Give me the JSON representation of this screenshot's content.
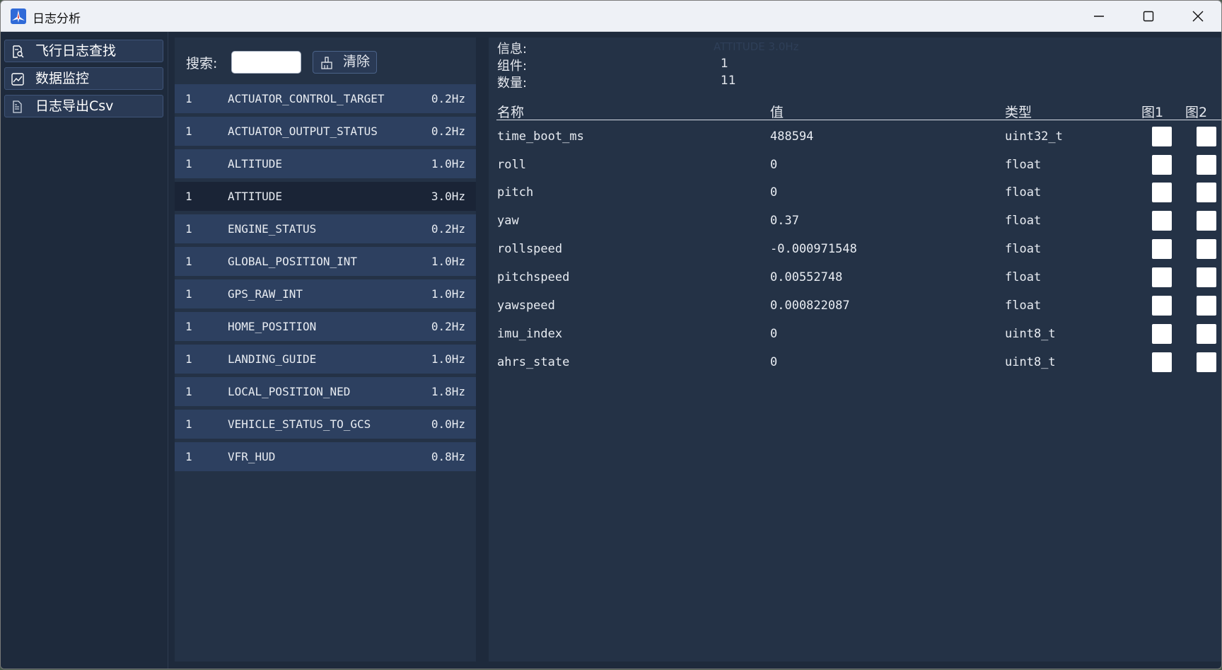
{
  "window": {
    "title": "日志分析",
    "minimize_icon": "minimize-icon",
    "maximize_icon": "maximize-icon",
    "close_icon": "close-icon"
  },
  "sidebar": {
    "items": [
      {
        "label": "飞行日志查找",
        "icon": "log-search-icon"
      },
      {
        "label": "数据监控",
        "icon": "chart-icon"
      },
      {
        "label": "日志导出Csv",
        "icon": "export-file-icon"
      }
    ]
  },
  "messages": {
    "search_label": "搜索:",
    "search_value": "",
    "clear_label": "清除",
    "clear_icon": "broom-icon",
    "rows": [
      {
        "id": "1",
        "name": "ACTUATOR_CONTROL_TARGET",
        "rate": "0.2Hz"
      },
      {
        "id": "1",
        "name": "ACTUATOR_OUTPUT_STATUS",
        "rate": "0.2Hz"
      },
      {
        "id": "1",
        "name": "ALTITUDE",
        "rate": "1.0Hz"
      },
      {
        "id": "1",
        "name": "ATTITUDE",
        "rate": "3.0Hz"
      },
      {
        "id": "1",
        "name": "ENGINE_STATUS",
        "rate": "0.2Hz"
      },
      {
        "id": "1",
        "name": "GLOBAL_POSITION_INT",
        "rate": "1.0Hz"
      },
      {
        "id": "1",
        "name": "GPS_RAW_INT",
        "rate": "1.0Hz"
      },
      {
        "id": "1",
        "name": "HOME_POSITION",
        "rate": "0.2Hz"
      },
      {
        "id": "1",
        "name": "LANDING_GUIDE",
        "rate": "1.0Hz"
      },
      {
        "id": "1",
        "name": "LOCAL_POSITION_NED",
        "rate": "1.8Hz"
      },
      {
        "id": "1",
        "name": "VEHICLE_STATUS_TO_GCS",
        "rate": "0.0Hz"
      },
      {
        "id": "1",
        "name": "VFR_HUD",
        "rate": "0.8Hz"
      }
    ],
    "selected": "ATTITUDE"
  },
  "detail": {
    "info_label": "信息:",
    "info_value": "ATTITUDE 3.0Hz",
    "component_label": "组件:",
    "component_value": "1",
    "count_label": "数量:",
    "count_value": "11",
    "headers": {
      "name": "名称",
      "value": "值",
      "type": "类型",
      "plot1": "图1",
      "plot2": "图2"
    },
    "fields": [
      {
        "name": "time_boot_ms",
        "value": "488594",
        "type": "uint32_t"
      },
      {
        "name": "roll",
        "value": "0",
        "type": "float"
      },
      {
        "name": "pitch",
        "value": "0",
        "type": "float"
      },
      {
        "name": "yaw",
        "value": "0.37",
        "type": "float"
      },
      {
        "name": "rollspeed",
        "value": "-0.000971548",
        "type": "float"
      },
      {
        "name": "pitchspeed",
        "value": "0.00552748",
        "type": "float"
      },
      {
        "name": "yawspeed",
        "value": "0.000822087",
        "type": "float"
      },
      {
        "name": "imu_index",
        "value": "0",
        "type": "uint8_t"
      },
      {
        "name": "ahrs_state",
        "value": "0",
        "type": "uint8_t"
      }
    ]
  }
}
